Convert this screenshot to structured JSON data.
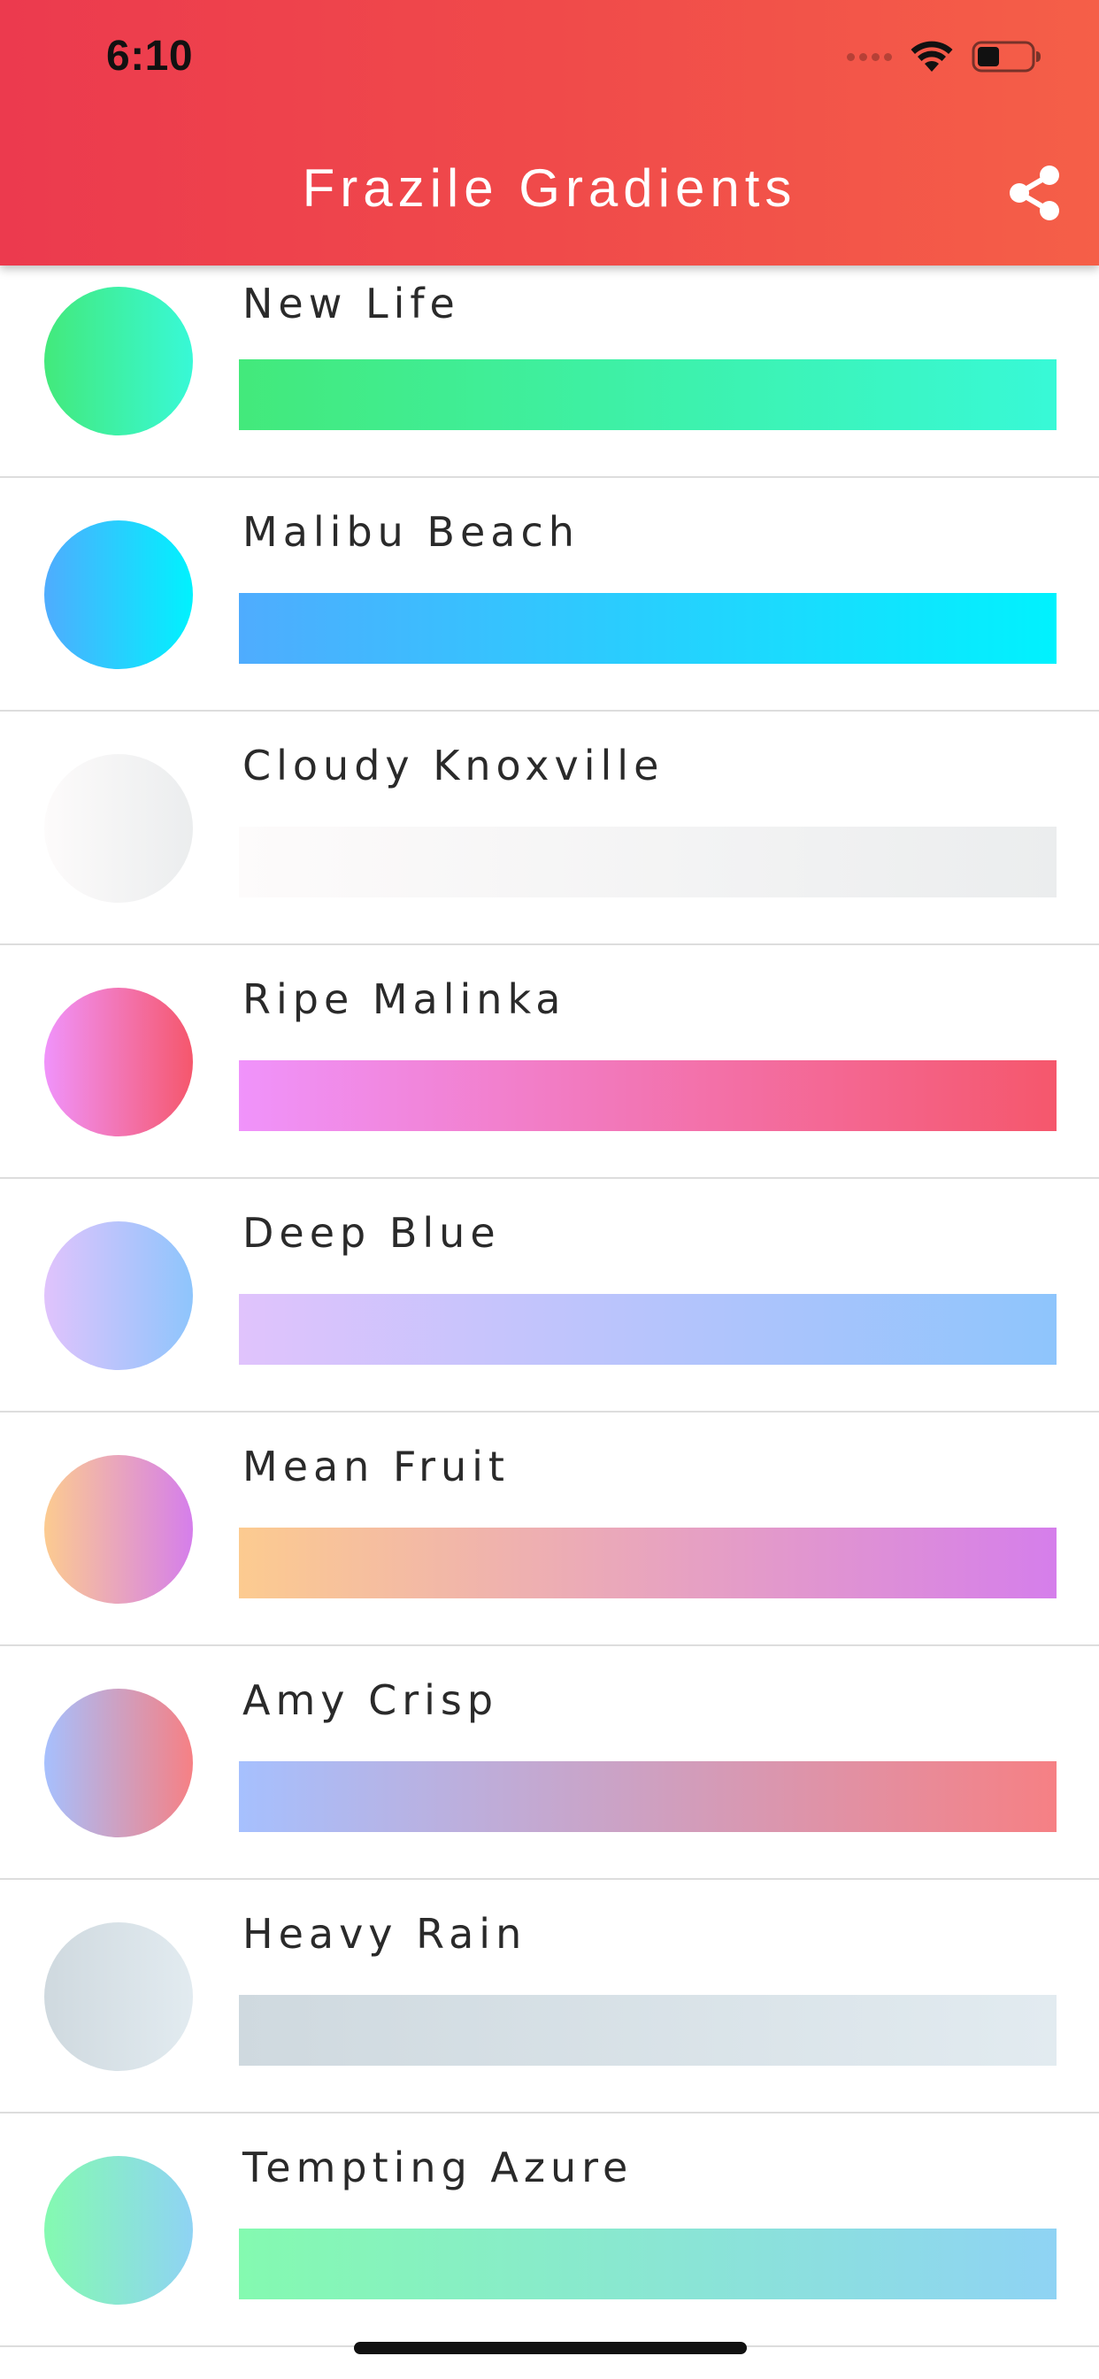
{
  "status_bar": {
    "time": "6:10",
    "icons": [
      "signal-dots-icon",
      "wifi-icon",
      "battery-icon"
    ]
  },
  "header": {
    "title": "Frazile Gradients",
    "share_icon": "share-icon",
    "gradient": [
      "#ec3a4e",
      "#f55f48"
    ]
  },
  "gradients": [
    {
      "name": "New Life",
      "colors": [
        "#43e97b",
        "#38f9d7"
      ]
    },
    {
      "name": "Malibu Beach",
      "colors": [
        "#4facfe",
        "#00f2fe"
      ]
    },
    {
      "name": "Cloudy Knoxville",
      "colors": [
        "#fdfbfb",
        "#ebedee"
      ]
    },
    {
      "name": "Ripe Malinka",
      "colors": [
        "#f093fb",
        "#f5576c"
      ]
    },
    {
      "name": "Deep Blue",
      "colors": [
        "#e0c3fc",
        "#8ec5fc"
      ]
    },
    {
      "name": "Mean Fruit",
      "colors": [
        "#fccb90",
        "#d57eeb"
      ]
    },
    {
      "name": "Amy Crisp",
      "colors": [
        "#a6c0fe",
        "#f68084"
      ]
    },
    {
      "name": "Heavy Rain",
      "colors": [
        "#cfd9df",
        "#e2ebf0"
      ]
    },
    {
      "name": "Tempting Azure",
      "colors": [
        "#84fab0",
        "#8fd3f4"
      ]
    }
  ]
}
